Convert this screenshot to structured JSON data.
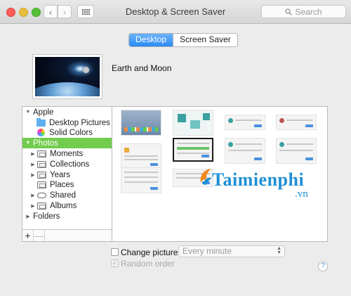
{
  "window": {
    "title": "Desktop & Screen Saver"
  },
  "toolbar": {
    "search_placeholder": "Search"
  },
  "tabs": [
    {
      "label": "Desktop",
      "active": true
    },
    {
      "label": "Screen Saver",
      "active": false
    }
  ],
  "current_picture": {
    "name": "Earth and Moon"
  },
  "sidebar": {
    "items": [
      {
        "label": "Apple",
        "level": 0,
        "expanded": true
      },
      {
        "label": "Desktop Pictures",
        "level": 1,
        "icon": "folder-icon"
      },
      {
        "label": "Solid Colors",
        "level": 1,
        "icon": "color-wheel-icon"
      },
      {
        "label": "Photos",
        "level": 0,
        "expanded": true,
        "selected": true
      },
      {
        "label": "Moments",
        "level": 1,
        "icon": "album-icon"
      },
      {
        "label": "Collections",
        "level": 1,
        "icon": "album-icon"
      },
      {
        "label": "Years",
        "level": 1,
        "icon": "album-icon"
      },
      {
        "label": "Places",
        "level": 1,
        "icon": "album-icon"
      },
      {
        "label": "Shared",
        "level": 1,
        "icon": "cloud-icon"
      },
      {
        "label": "Albums",
        "level": 1,
        "icon": "album-icon"
      },
      {
        "label": "Folders",
        "level": 0,
        "expanded": false
      }
    ],
    "add_label": "+",
    "remove_label": "—"
  },
  "options": {
    "change_picture_label": "Change picture:",
    "change_picture_checked": false,
    "interval": "Every minute",
    "random_order_label": "Random order",
    "random_order_checked": true,
    "help_label": "?"
  },
  "watermark": {
    "text": "Taimienphi",
    "suffix": ".vn"
  },
  "colors": {
    "accent": "#2a8af6",
    "sidebar_selected": "#72cc4e",
    "watermark": "#1f8fd4"
  }
}
